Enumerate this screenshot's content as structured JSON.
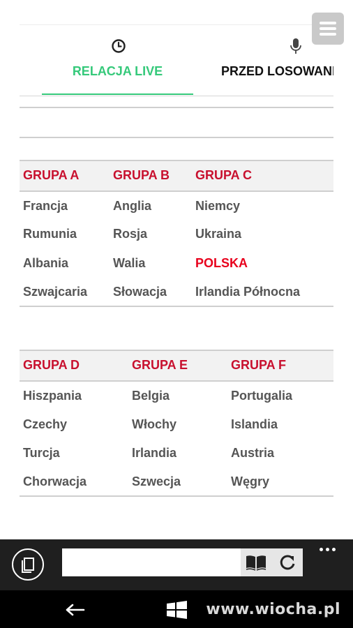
{
  "tabs": [
    {
      "label": "RELACJA LIVE",
      "icon": "clock-icon",
      "active": true
    },
    {
      "label": "PRZED LOSOWANIEM",
      "icon": "microphone-icon",
      "active": false
    }
  ],
  "groups_top": {
    "headers": [
      "GRUPA A",
      "GRUPA B",
      "GRUPA C"
    ],
    "rows": [
      [
        "Francja",
        "Anglia",
        "Niemcy"
      ],
      [
        "Rumunia",
        "Rosja",
        "Ukraina"
      ],
      [
        "Albania",
        "Walia",
        "POLSKA"
      ],
      [
        "Szwajcaria",
        "Słowacja",
        "Irlandia Północna"
      ]
    ]
  },
  "groups_bottom": {
    "headers": [
      "GRUPA D",
      "GRUPA E",
      "GRUPA F"
    ],
    "rows": [
      [
        "Hiszpania",
        "Belgia",
        "Portugalia"
      ],
      [
        "Czechy",
        "Włochy",
        "Islandia"
      ],
      [
        "Turcja",
        "Irlandia",
        "Austria"
      ],
      [
        "Chorwacja",
        "Szwecja",
        "Węgry"
      ]
    ]
  },
  "browser": {
    "address_value": "",
    "icons": [
      "tabs-icon",
      "reader-icon",
      "refresh-icon",
      "more-icon"
    ]
  },
  "watermark": "www.wiocha.pl",
  "colors": {
    "accent_green": "#35c97a",
    "group_red": "#c8102e",
    "highlight_red": "#e8001c"
  }
}
